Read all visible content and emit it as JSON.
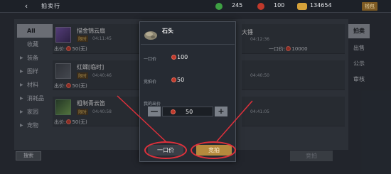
{
  "header": {
    "title": "拍卖行",
    "currencies": [
      {
        "icon": "jade-icon",
        "value": "245",
        "color": "#3ea043"
      },
      {
        "icon": "ruby-icon",
        "value": "100",
        "color": "#c0392b"
      },
      {
        "icon": "gold-icon",
        "value": "134654",
        "color": "#d6a23a"
      }
    ],
    "recharge_label": "钱包"
  },
  "sidebar": {
    "items": [
      {
        "label": "All",
        "active": true
      },
      {
        "label": "收藏"
      },
      {
        "label": "装备"
      },
      {
        "label": "图样"
      },
      {
        "label": "材料"
      },
      {
        "label": "消耗品"
      },
      {
        "label": "家园"
      },
      {
        "label": "宠物"
      }
    ]
  },
  "listings": [
    {
      "name": "描金锦云扇",
      "tag": "限时",
      "time": "04:11:45",
      "price_label": "出价:",
      "price": "50",
      "price_note": "(无)"
    },
    {
      "name": "红蝶[临时]",
      "tag": "限时",
      "time": "04:40:46",
      "price_label": "出价:",
      "price": "50",
      "price_note": "(无)"
    },
    {
      "name": "粗制青云笛",
      "tag": "限时",
      "time": "04:40:58",
      "price_label": "出价:",
      "price": "50",
      "price_note": "(无)"
    }
  ],
  "right_listings": [
    {
      "name": "大锤",
      "time": "04:12:36",
      "price_label": "一口价:",
      "price": "10000"
    },
    {
      "time": "04:40:50"
    },
    {
      "time": "04:41:05"
    }
  ],
  "right_tabs": [
    {
      "label": "拍卖",
      "active": true
    },
    {
      "label": "出售"
    },
    {
      "label": "公示"
    },
    {
      "label": "审核"
    }
  ],
  "bottom": {
    "search_label": "搜索",
    "bid_label": "竞拍"
  },
  "dialog": {
    "item_name": "石头",
    "fixed_price_label": "一口价",
    "fixed_price": "100",
    "bid_price_label": "竞拍价",
    "bid_price": "50",
    "my_bid_label": "我的出价",
    "my_bid_value": "50",
    "minus": "—",
    "plus": "+",
    "buyout_button": "一口价",
    "bid_button": "竞拍"
  }
}
